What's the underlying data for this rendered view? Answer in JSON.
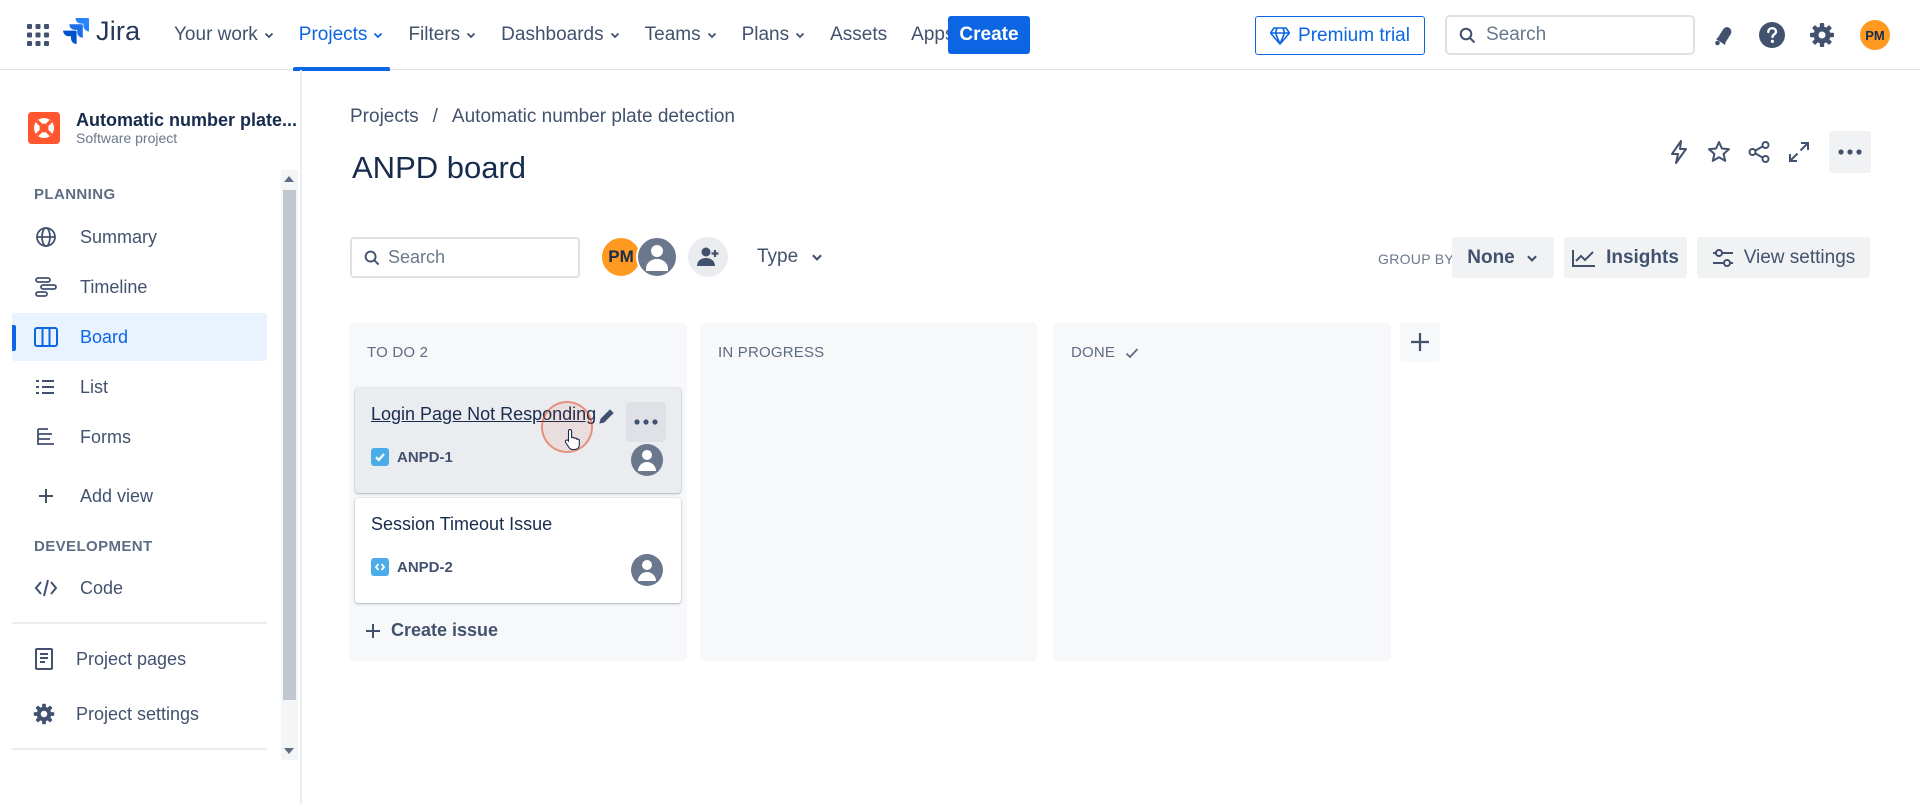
{
  "nav": {
    "logo": "Jira",
    "items": [
      {
        "label": "Your work",
        "dropdown": true
      },
      {
        "label": "Projects",
        "dropdown": true,
        "active": true
      },
      {
        "label": "Filters",
        "dropdown": true
      },
      {
        "label": "Dashboards",
        "dropdown": true
      },
      {
        "label": "Teams",
        "dropdown": true
      },
      {
        "label": "Plans",
        "dropdown": true
      },
      {
        "label": "Assets",
        "dropdown": false
      },
      {
        "label": "Apps",
        "dropdown": true
      }
    ],
    "create_label": "Create",
    "premium_label": "Premium trial",
    "search_placeholder": "Search",
    "user_initials": "PM"
  },
  "sidebar": {
    "project_name": "Automatic number plate...",
    "project_type": "Software project",
    "planning_label": "PLANNING",
    "planning_items": [
      {
        "label": "Summary",
        "icon": "globe-icon"
      },
      {
        "label": "Timeline",
        "icon": "timeline-icon"
      },
      {
        "label": "Board",
        "icon": "board-icon",
        "active": true
      },
      {
        "label": "List",
        "icon": "list-icon"
      },
      {
        "label": "Forms",
        "icon": "forms-icon"
      }
    ],
    "add_view_label": "Add view",
    "development_label": "DEVELOPMENT",
    "code_label": "Code",
    "project_pages_label": "Project pages",
    "project_settings_label": "Project settings"
  },
  "main": {
    "breadcrumb": [
      "Projects",
      "Automatic number plate detection"
    ],
    "breadcrumb_sep": "/",
    "title": "ANPD board",
    "search_placeholder": "Search",
    "avatar_initials": "PM",
    "type_filter": "Type",
    "group_by_label": "GROUP BY",
    "group_by_value": "None",
    "insights_label": "Insights",
    "view_settings_label": "View settings"
  },
  "board": {
    "columns": [
      {
        "title": "TO DO 2",
        "cards": [
          {
            "title": "Login Page Not Responding",
            "key": "ANPD-1",
            "type": "task",
            "hovered": true
          },
          {
            "title": "Session Timeout Issue",
            "key": "ANPD-2",
            "type": "subtask"
          }
        ],
        "create_label": "Create issue"
      },
      {
        "title": "IN PROGRESS",
        "cards": []
      },
      {
        "title": "DONE",
        "done": true,
        "cards": []
      }
    ]
  },
  "colors": {
    "accent": "#0c66e4",
    "avatar_orange": "#ff991f",
    "column_bg": "#f7f8f9"
  }
}
